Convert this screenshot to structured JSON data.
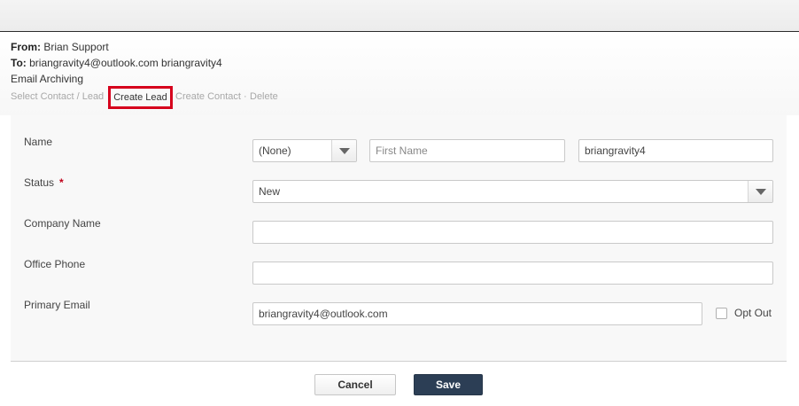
{
  "header": {
    "from_label": "From:",
    "from_value": "Brian Support",
    "to_label": "To:",
    "to_value": "briangravity4@outlook.com briangravity4",
    "subject": "Email Archiving"
  },
  "actions": {
    "select_contact_lead": "Select Contact / Lead",
    "create_lead": "Create Lead",
    "create_contact": "Create Contact",
    "separator": "·",
    "delete": "Delete"
  },
  "form": {
    "name_label": "Name",
    "salutation_value": "(None)",
    "first_name_placeholder": "First Name",
    "last_name_value": "briangravity4",
    "status_label": "Status",
    "status_required": "*",
    "status_value": "New",
    "company_label": "Company Name",
    "company_value": "",
    "phone_label": "Office Phone",
    "phone_value": "",
    "email_label": "Primary Email",
    "email_value": "briangravity4@outlook.com",
    "opt_out_label": "Opt Out",
    "opt_out_checked": false
  },
  "buttons": {
    "cancel": "Cancel",
    "save": "Save"
  },
  "colors": {
    "save_button": "#2c3e55",
    "highlight_box": "#d6001c",
    "required_marker": "#c0001a"
  },
  "icons": {
    "dropdown": "chevron-down-icon"
  }
}
